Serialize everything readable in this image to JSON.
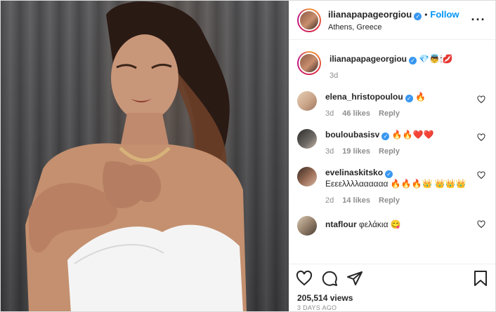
{
  "post": {
    "username": "ilianapapageorgiou",
    "location": "Athens, Greece",
    "follow_label": "Follow",
    "dot": "•",
    "caption_emojis": "💎👼🕯💋",
    "caption_time": "3d",
    "views": "205,514 views",
    "date_hint": "3 DAYS AGO"
  },
  "comments": [
    {
      "username": "elena_hristopoulou",
      "text": "🔥",
      "time": "3d",
      "likes": "46 likes",
      "reply": "Reply",
      "verified": true
    },
    {
      "username": "bouloubasisv",
      "text": "🔥🔥❤️❤️",
      "time": "3d",
      "likes": "19 likes",
      "reply": "Reply",
      "verified": true
    },
    {
      "username": "evelinaskitsko",
      "text": "Εεεελλλλαααααα 🔥🔥🔥👑 👑👑👑",
      "time": "2d",
      "likes": "14 likes",
      "reply": "Reply",
      "verified": true
    },
    {
      "username": "ntaflour",
      "text": "φελάκια 😋",
      "time": "",
      "likes": "",
      "reply": "",
      "verified": false
    }
  ],
  "icons": {
    "verified": "verified-badge-icon",
    "more": "more-options-icon",
    "like": "heart-icon",
    "comment": "comment-icon",
    "share": "share-icon",
    "save": "bookmark-icon"
  },
  "colors": {
    "accent": "#0095f6",
    "verified": "#3897f0",
    "muted": "#8e8e8e"
  }
}
